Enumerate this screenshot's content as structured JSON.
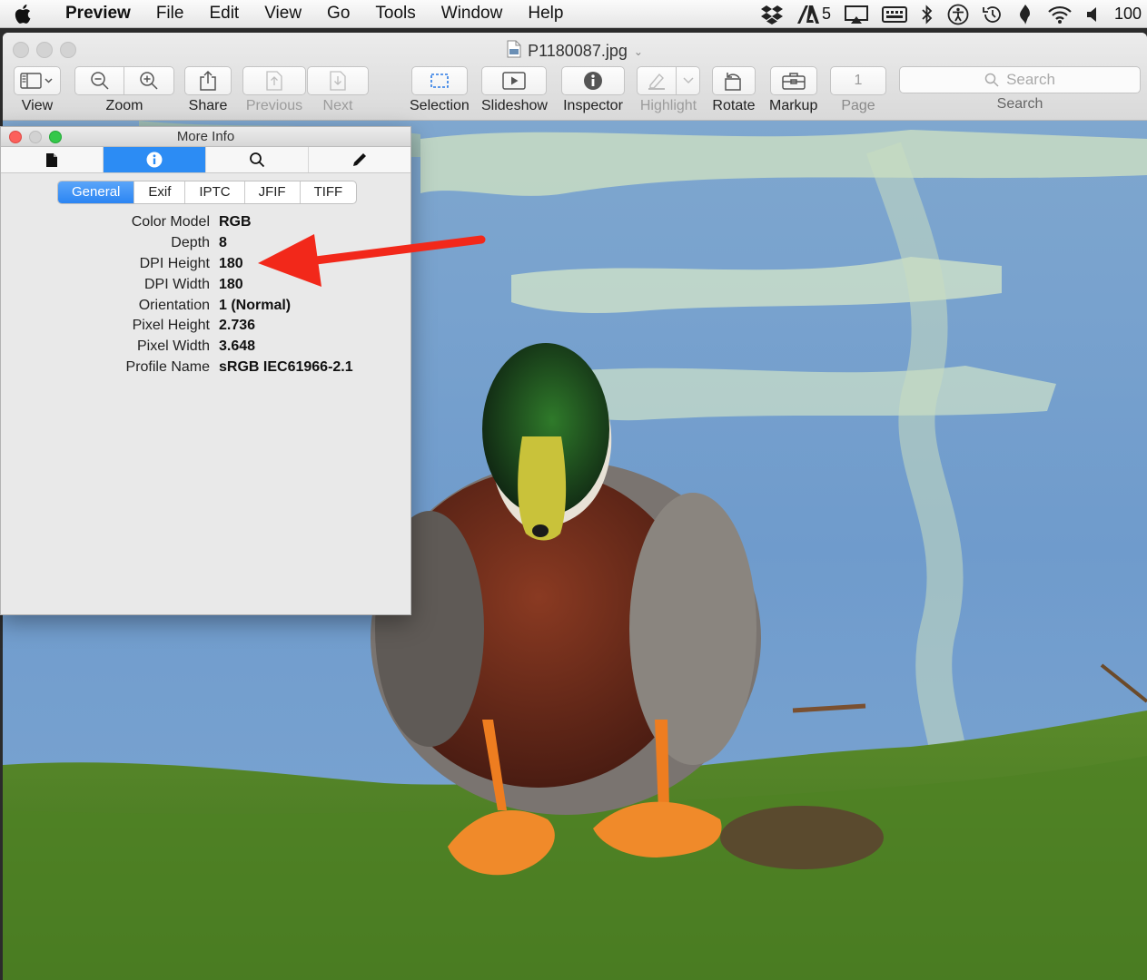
{
  "menubar": {
    "apple_icon": "apple-icon",
    "app_name": "Preview",
    "items": [
      "File",
      "Edit",
      "View",
      "Go",
      "Tools",
      "Window",
      "Help"
    ],
    "status": {
      "adobe_badge": "5",
      "battery_text": "100"
    }
  },
  "window": {
    "document_title": "P1180087.jpg",
    "toolbar": {
      "view_label": "View",
      "zoom_label": "Zoom",
      "share_label": "Share",
      "previous_label": "Previous",
      "next_label": "Next",
      "selection_label": "Selection",
      "slideshow_label": "Slideshow",
      "inspector_label": "Inspector",
      "highlight_label": "Highlight",
      "rotate_label": "Rotate",
      "markup_label": "Markup",
      "page_value": "1",
      "page_label": "Page",
      "search_placeholder": "Search",
      "search_label": "Search"
    }
  },
  "more_info": {
    "title": "More Info",
    "icon_tabs": [
      "document-icon",
      "info-icon",
      "magnifier-icon",
      "pencil-icon"
    ],
    "active_icon_tab": "info-icon",
    "subtabs": [
      "General",
      "Exif",
      "IPTC",
      "JFIF",
      "TIFF"
    ],
    "active_subtab": "General",
    "properties": [
      {
        "key": "Color Model",
        "value": "RGB"
      },
      {
        "key": "Depth",
        "value": "8"
      },
      {
        "key": "DPI Height",
        "value": "180"
      },
      {
        "key": "DPI Width",
        "value": "180"
      },
      {
        "key": "Orientation",
        "value": "1 (Normal)"
      },
      {
        "key": "Pixel Height",
        "value": "2.736"
      },
      {
        "key": "Pixel Width",
        "value": "3.648"
      },
      {
        "key": "Profile Name",
        "value": "sRGB IEC61966-2.1"
      }
    ]
  },
  "colors": {
    "accent_blue": "#2c8cf4",
    "annotation_red": "#f2281a",
    "close_red": "#fc605b",
    "zoom_green": "#34c84a"
  }
}
